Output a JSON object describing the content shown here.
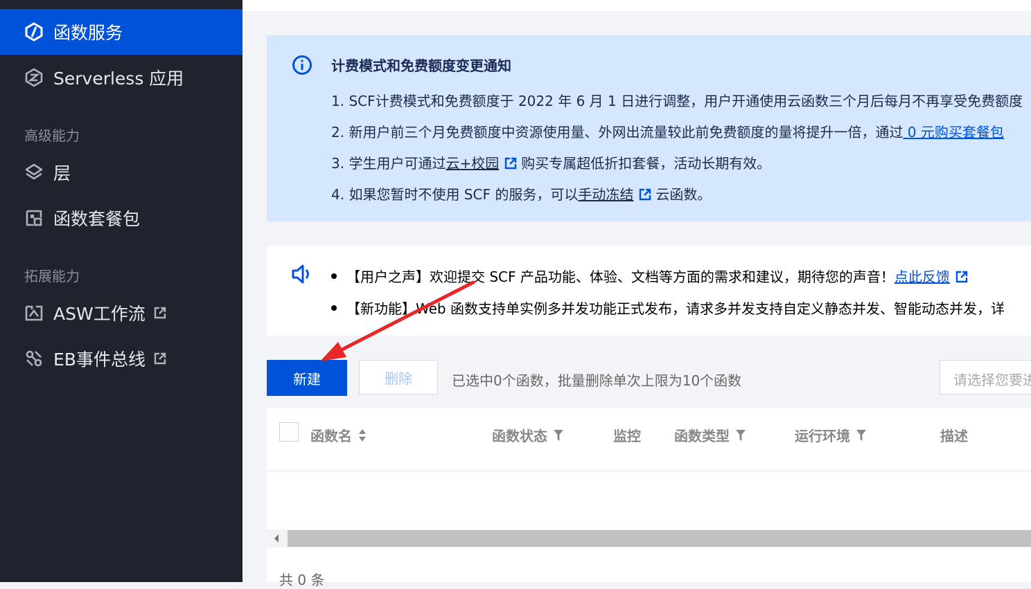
{
  "sidebar": {
    "items": [
      {
        "label": "函数服务",
        "icon": "function-service-icon",
        "active": true
      },
      {
        "label": "Serverless 应用",
        "icon": "serverless-app-icon"
      },
      {
        "label": "层",
        "icon": "layers-icon"
      },
      {
        "label": "函数套餐包",
        "icon": "package-icon"
      },
      {
        "label": "ASW工作流",
        "icon": "workflow-icon",
        "external": true
      },
      {
        "label": "EB事件总线",
        "icon": "event-bus-icon",
        "external": true
      }
    ],
    "groups": [
      "高级能力",
      "拓展能力"
    ]
  },
  "notice": {
    "title": "计费模式和免费额度变更通知",
    "line1": "1. SCF计费模式和免费额度于 2022 年 6 月 1 日进行调整，用户开通使用云函数三个月后每月不再享受免费额度",
    "line2_prefix": "2. 新用户前三个月免费额度中资源使用量、外网出流量较此前免费额度的量将提升一倍，通过",
    "line2_link": " 0 元购买套餐包",
    "line3_prefix": "3. 学生用户可通过",
    "line3_link": "云+校园",
    "line3_suffix": "购买专属超低折扣套餐，活动长期有效。",
    "line4_prefix": "4. 如果您暂时不使用 SCF 的服务，可以",
    "line4_link": "手动冻结",
    "line4_suffix": "云函数。"
  },
  "voice": {
    "item1_prefix": "【用户之声】欢迎提交 SCF 产品功能、体验、文档等方面的需求和建议，期待您的声音！",
    "item1_link": "点此反馈",
    "item2": "【新功能】Web 函数支持单实例多并发功能正式发布，请求多并发支持自定义静态并发、智能动态并发，详"
  },
  "toolbar": {
    "new_label": "新建",
    "delete_label": "删除",
    "selection_text": "已选中0个函数，批量删除单次上限为10个函数",
    "search_placeholder": "请选择您要进"
  },
  "table": {
    "columns": [
      "函数名",
      "函数状态",
      "监控",
      "函数类型",
      "运行环境",
      "描述"
    ],
    "total_text": "共 0 条"
  },
  "colors": {
    "sidebar_bg": "#1f232d",
    "accent": "#0052d9",
    "notice_bg": "#d5e7ff",
    "annotation_arrow": "#e8272a"
  }
}
